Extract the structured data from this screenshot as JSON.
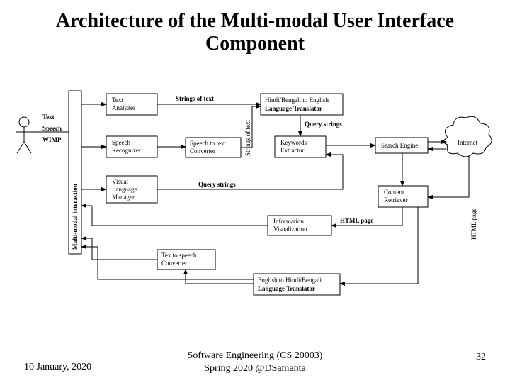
{
  "title": "Architecture of the Multi-modal User Interface Component",
  "footer": {
    "date": "10 January, 2020",
    "center_line1": "Software Engineering (CS 20003)",
    "center_line2": "Spring 2020 @DSamanta",
    "page": "32"
  },
  "diagram": {
    "user_inputs": {
      "text": "Text",
      "speech": "Speech",
      "wimp": "WIMP"
    },
    "mmi_label": "Multi-modal interaction",
    "boxes": {
      "text_analyzer": "Text\nAnalyzer",
      "speech_recognizer": "Speech\nRecognizer",
      "visual_lang_mgr": "Visual\nLanguage\nManager",
      "speech_to_text": "Speech to text\nConverter",
      "translator_in_l1": "Hindi/Bengali to English",
      "translator_in_l2": "Language Translator",
      "keywords_extractor": "Keywords\nExtractor",
      "search_engine": "Search Engine",
      "internet": "Internet",
      "content_retriever": "Content\nRetriever",
      "info_viz": "Information\nVisualization",
      "text_to_speech": "Tex to speech\nConverter",
      "translator_out_l1": "English to Hindi/Bengali",
      "translator_out_l2": "Language Translator"
    },
    "edge_labels": {
      "strings_of_text_h": "Strings of text",
      "strings_of_text_v": "Strings of text",
      "query_strings_top": "Query strings",
      "query_strings_mid": "Query strings",
      "html_page_h": "HTML page",
      "html_page_v": "HTML page"
    }
  }
}
